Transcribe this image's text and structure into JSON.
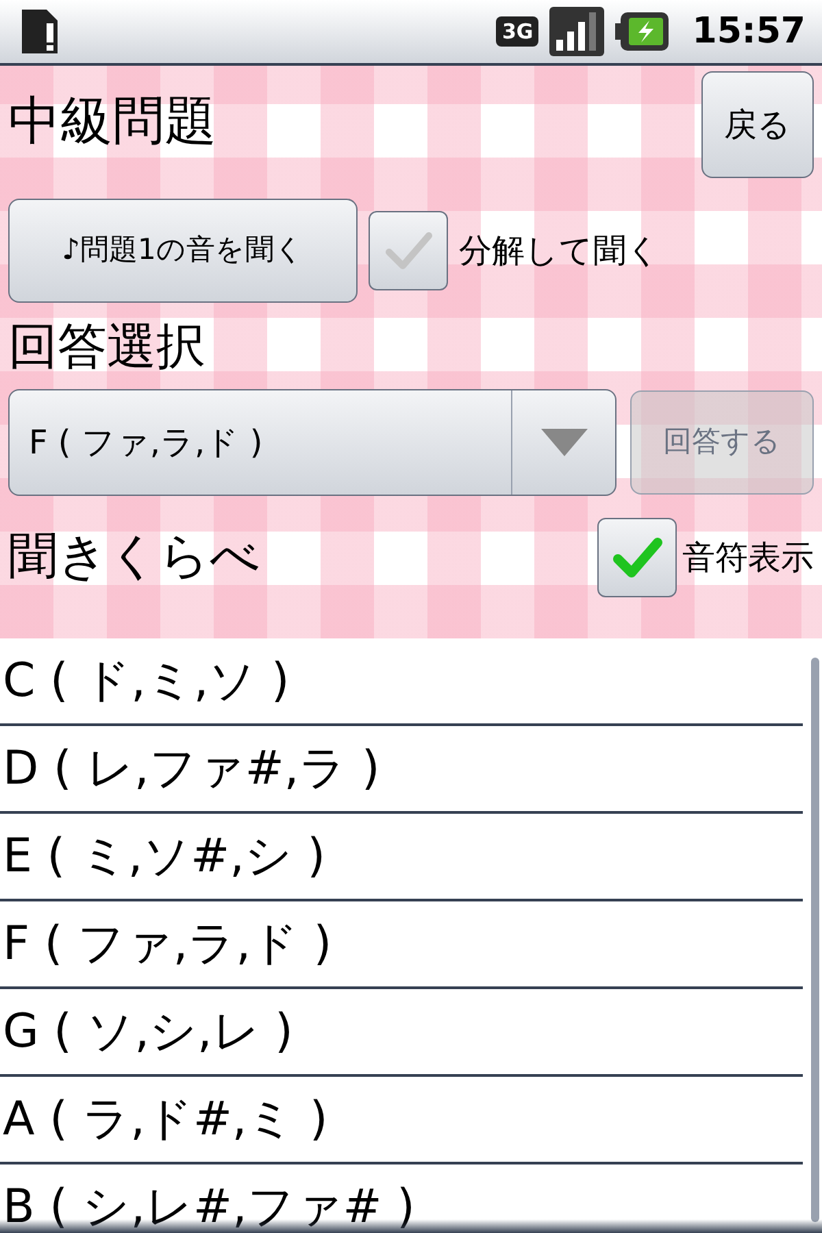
{
  "status_bar": {
    "network": "3G",
    "time": "15:57"
  },
  "header": {
    "title": "中級問題",
    "back_button": "戻る"
  },
  "play": {
    "button": "♪問題1の音を聞く",
    "split_checkbox": {
      "label": "分解して聞く",
      "checked": false
    }
  },
  "answer": {
    "heading": "回答選択",
    "dropdown_value": "F ( ファ,ラ,ド )",
    "submit_button": "回答する",
    "submit_disabled": true
  },
  "compare": {
    "heading": "聞きくらべ",
    "notes_checkbox": {
      "label": "音符表示",
      "checked": true
    }
  },
  "chords": [
    {
      "label": "C ( ド,ミ,ソ )"
    },
    {
      "label": "D ( レ,ファ#,ラ )"
    },
    {
      "label": "E ( ミ,ソ#,シ )"
    },
    {
      "label": "F ( ファ,ラ,ド )"
    },
    {
      "label": "G ( ソ,シ,レ )"
    },
    {
      "label": "A ( ラ,ド#,ミ )"
    },
    {
      "label": "B ( シ,レ#,ファ# )"
    }
  ]
}
